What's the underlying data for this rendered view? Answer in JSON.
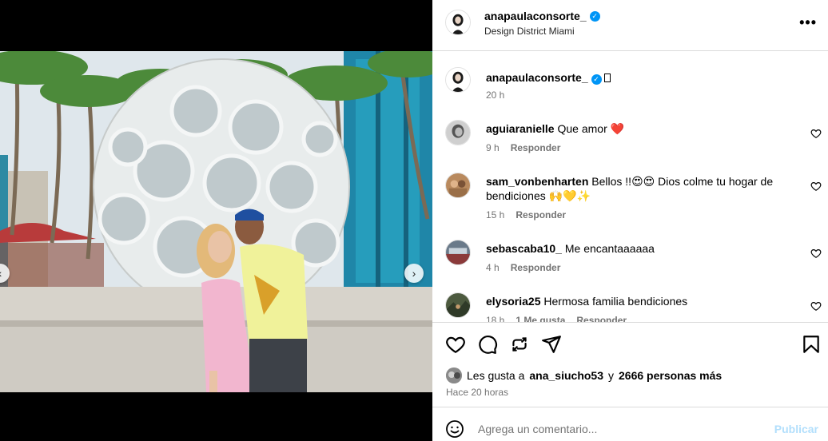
{
  "post": {
    "username": "anapaulaconsorte_",
    "location": "Design District Miami",
    "more_label": "•••"
  },
  "caption": {
    "username": "anapaulaconsorte_",
    "text": "",
    "time": "20 h"
  },
  "comments": [
    {
      "username": "aguiaranielle",
      "text": "Que amor ❤️",
      "time": "9 h",
      "likes": "",
      "reply": "Responder"
    },
    {
      "username": "sam_vonbenharten",
      "text": "Bellos !!😍😍 Dios colme tu hogar de bendiciones 🙌💛✨",
      "time": "15 h",
      "likes": "",
      "reply": "Responder"
    },
    {
      "username": "sebascaba10_",
      "text": "Me encantaaaaaa",
      "time": "4 h",
      "likes": "",
      "reply": "Responder"
    },
    {
      "username": "elysoria25",
      "text": "Hermosa familia bendiciones",
      "time": "18 h",
      "likes": "1 Me gusta",
      "reply": "Responder"
    }
  ],
  "likes": {
    "prefix": "Les gusta a",
    "user": "ana_siucho53",
    "joiner": "y",
    "others": "2666 personas más"
  },
  "timestamp": "Hace 20 horas",
  "add_comment": {
    "placeholder": "Agrega un comentario...",
    "post_label": "Publicar"
  },
  "carousel": {
    "dot_count": 6,
    "active_index": 1
  },
  "colors": {
    "accent": "#0095f6",
    "post_disabled": "#b2dffc",
    "secondary_text": "#737373",
    "heart_red": "#ed4956"
  },
  "icons": [
    "heart-icon",
    "comment-icon",
    "share-icon",
    "send-icon",
    "bookmark-icon",
    "emoji-icon",
    "verified-icon",
    "more-icon",
    "chevron-right-icon",
    "chevron-left-icon"
  ]
}
